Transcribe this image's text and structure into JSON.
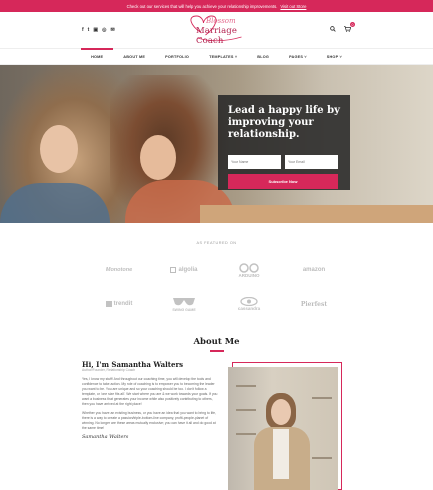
{
  "topbar": {
    "message": "Check out our services that will help you achieve your relationship improvements.",
    "link": "Visit out Store"
  },
  "header": {
    "social_icons": [
      "f",
      "t",
      "▣",
      "◎",
      "✉"
    ],
    "logo_script": "Blossom",
    "logo_main": "Marriage Coach",
    "cart_count": "0"
  },
  "nav": {
    "items": [
      "HOME",
      "ABOUT ME",
      "PORTFOLIO",
      "TEMPLATES ˅",
      "BLOG",
      "PAGES ˅",
      "SHOP ˅"
    ]
  },
  "hero": {
    "heading": "Lead a happy life by improving your relationship.",
    "name_placeholder": "Your Name",
    "email_placeholder": "Your Email",
    "button": "Subscribe Now"
  },
  "featured": {
    "label": "AS FEATURED ON",
    "logos": [
      "Monotone",
      "algolia",
      "ARDUINO",
      "amazon",
      "trendit",
      "SWING GAME",
      "cassandra",
      "Pierfest"
    ]
  },
  "about": {
    "title": "About Me",
    "name": "Hi, I'm Samantha Walters",
    "role": "Author/Founder, Relationship Coach",
    "para1": "Yes, I know my stuff! And throughout our coaching time, you will develop the tools and confidence to take action. My role of coaching is to empower you to becoming the leader you want to be. You are unique and so your coaching should be too. I don't follow a template, or 'one size fits all'. We start where you are & we work towards your goals. If you want a business that generates your income while also positively contributing to others, then you have arrived at the right place!",
    "para2": "Whether you have an existing business, or you have an idea that you want to bring to life, there is a way to create a passion/triple-bottom-line company, profit-people-planet of winning. No longer are these areas mutually exclusive; you can have it all and do good at the same time!",
    "signature": "Samantha Walters"
  },
  "colors": {
    "accent": "#d6285a",
    "dark_panel": "#2b2b2b"
  }
}
